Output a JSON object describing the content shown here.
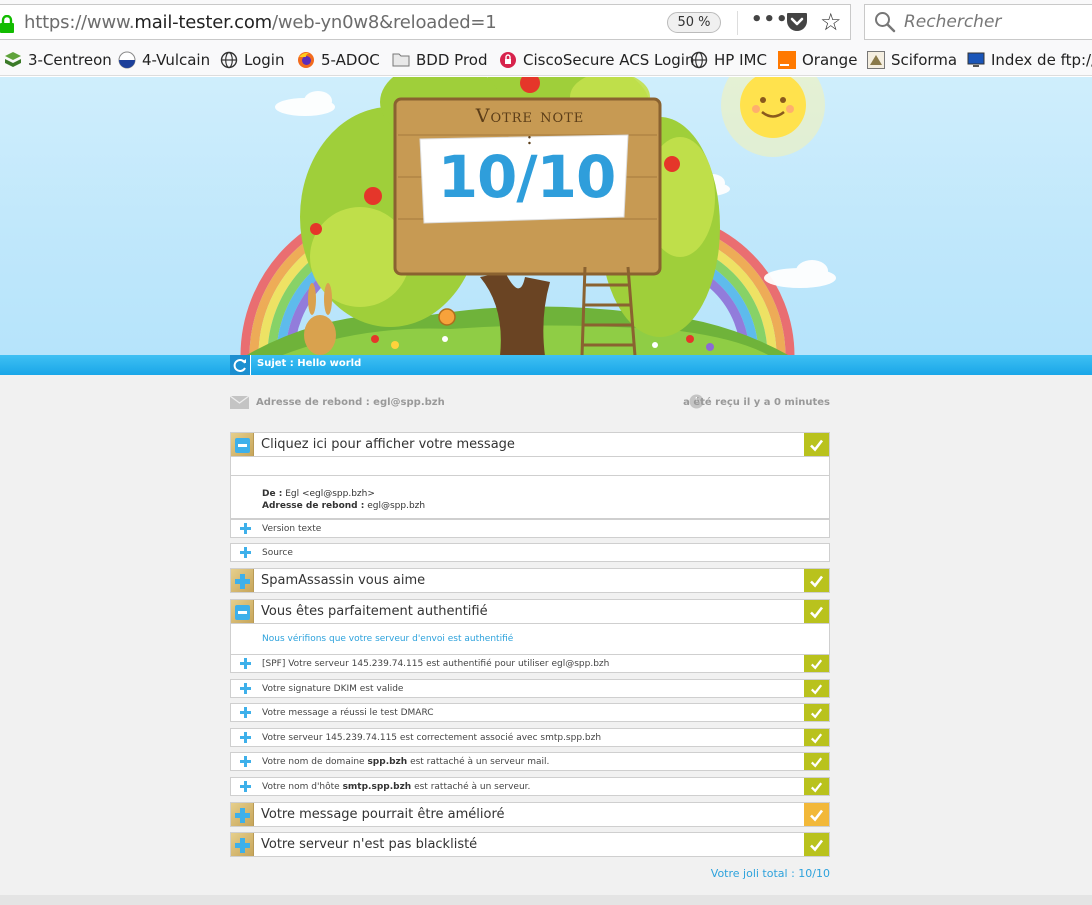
{
  "browser": {
    "url_prefix": "https://www.",
    "url_domain": "mail-tester.com",
    "url_path": "/web-yn0w8&reloaded=1",
    "zoom": "50 %",
    "search_placeholder": "Rechercher"
  },
  "bookmarks": [
    {
      "label": "3-Centreon",
      "icon": "centreon-icon"
    },
    {
      "label": "4-Vulcain",
      "icon": "vulcain-icon"
    },
    {
      "label": "Login",
      "icon": "globe-icon"
    },
    {
      "label": "5-ADOC",
      "icon": "firefox-icon"
    },
    {
      "label": "BDD Prod",
      "icon": "folder-icon"
    },
    {
      "label": "CiscoSecure ACS Login",
      "icon": "cisco-icon"
    },
    {
      "label": "HP IMC",
      "icon": "globe-icon"
    },
    {
      "label": "Orange",
      "icon": "orange-icon"
    },
    {
      "label": "Sciforma",
      "icon": "sciforma-icon"
    },
    {
      "label": "Index de ftp://f",
      "icon": "monitor-icon"
    }
  ],
  "banner": {
    "note_title": "Votre note :",
    "score": "10/10"
  },
  "subject": "Sujet : Hello world",
  "bounce": "Adresse de rebond : egl@spp.bzh",
  "received": "a été reçu il y a 0 minutes",
  "message_section": {
    "title": "Cliquez ici pour afficher votre message",
    "from_label": "De :",
    "from_value": "Egl <egl@spp.bzh>",
    "bounce_label": "Adresse de rebond :",
    "bounce_value": "egl@spp.bzh",
    "items": [
      "Version texte",
      "Source"
    ]
  },
  "spam_section": {
    "title": "SpamAssassin vous aime"
  },
  "auth_section": {
    "title": "Vous êtes parfaitement authentifié",
    "description": "Nous vérifions que votre serveur d'envoi est authentifié",
    "checks": [
      {
        "before": "[SPF] Votre serveur 145.239.74.115 est authentifié pour utiliser egl@spp.bzh",
        "bold": "",
        "after": ""
      },
      {
        "before": "Votre signature DKIM est valide",
        "bold": "",
        "after": ""
      },
      {
        "before": "Votre message a réussi le test DMARC",
        "bold": "",
        "after": ""
      },
      {
        "before": "Votre serveur 145.239.74.115 est correctement associé avec smtp.spp.bzh",
        "bold": "",
        "after": ""
      },
      {
        "before": "Votre nom de domaine ",
        "bold": "spp.bzh",
        "after": " est rattaché à un serveur mail."
      },
      {
        "before": "Votre nom d'hôte ",
        "bold": "smtp.spp.bzh",
        "after": " est rattaché à un serveur."
      }
    ]
  },
  "improve_section": {
    "title": "Votre message pourrait être amélioré"
  },
  "blacklist_section": {
    "title": "Votre serveur n'est pas blacklisté"
  },
  "total": "Votre joli total : 10/10",
  "colors": {
    "accent_blue": "#2da2dc",
    "check_green": "#b9c21d",
    "check_orange": "#f2b839"
  }
}
